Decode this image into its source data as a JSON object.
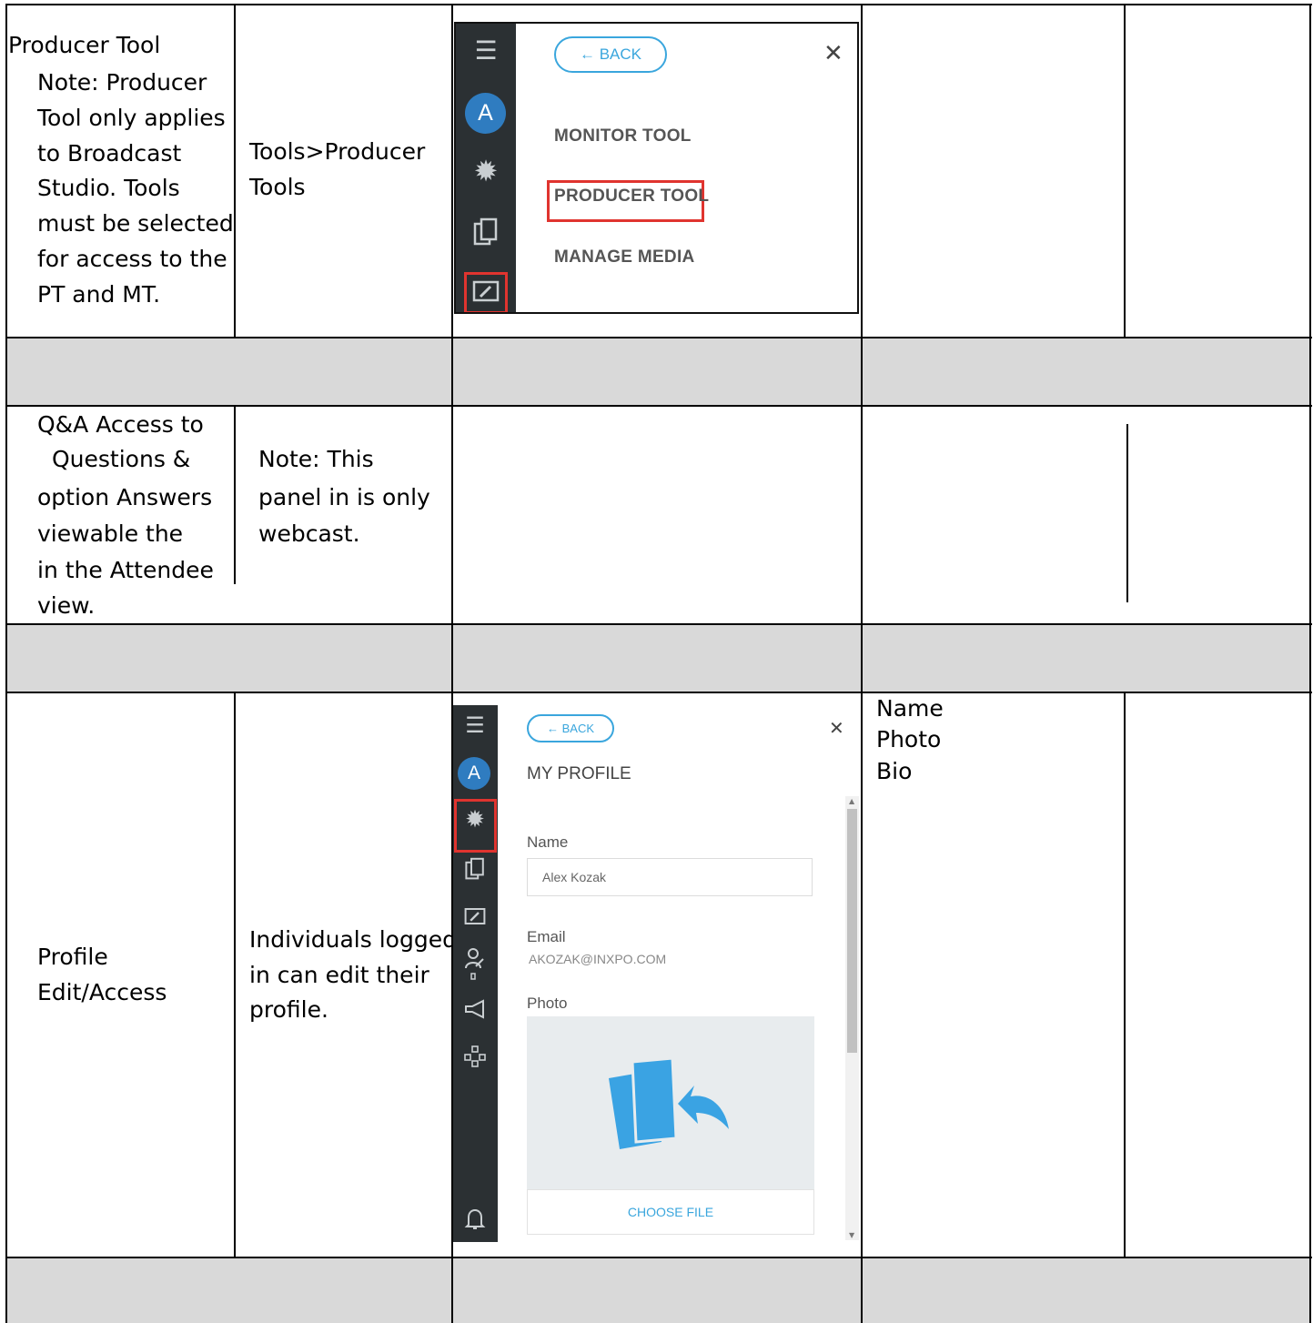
{
  "rows": {
    "producer": {
      "feature_title": "Producer Tool",
      "feature_note": [
        "Note: Producer",
        "Tool only applies",
        "to Broadcast",
        "Studio. Tools",
        "must be selected",
        "for access to the",
        "PT and MT."
      ],
      "location": [
        "Tools>Producer",
        "Tools"
      ],
      "screenshot": {
        "back_label": "← BACK",
        "menu_items": [
          "MONITOR TOOL",
          "PRODUCER TOOL",
          "MANAGE MEDIA"
        ],
        "avatar_letter": "A",
        "close_glyph": "✕"
      }
    },
    "qa": {
      "feature_lines": [
        "Q&A  Access to",
        "Questions &",
        "option Answers",
        "viewable the",
        "in the Attendee",
        "view."
      ],
      "note_lines": [
        "Note: This",
        "panel in is only",
        "webcast."
      ]
    },
    "profile": {
      "feature_lines": [
        "Profile",
        "Edit/Access"
      ],
      "description_lines": [
        "Individuals logged",
        "in can edit their",
        "profile."
      ],
      "fields_list": [
        "Name",
        "Photo",
        "Bio"
      ],
      "screenshot": {
        "back_label": "← BACK",
        "title": "MY PROFILE",
        "avatar_letter": "A",
        "close_glyph": "✕",
        "name_label": "Name",
        "name_value": "Alex Kozak",
        "email_label": "Email",
        "email_value": "AKOZAK@INXPO.COM",
        "photo_label": "Photo",
        "choose_file_label": "CHOOSE FILE"
      }
    }
  }
}
